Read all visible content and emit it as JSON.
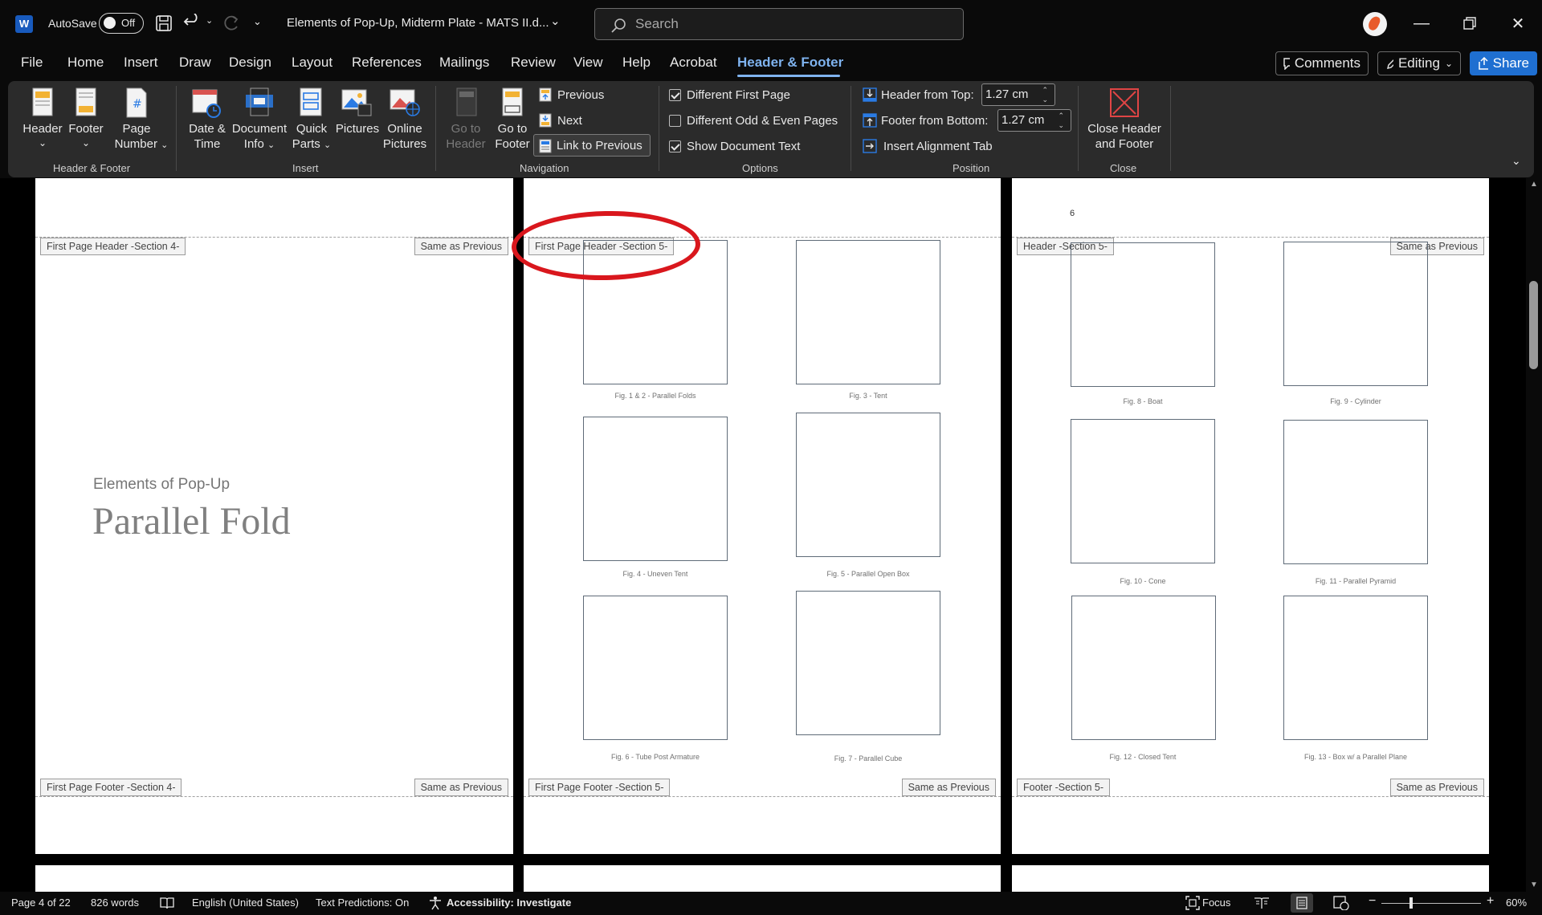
{
  "title_bar": {
    "autosave_label": "AutoSave",
    "autosave_state": "Off",
    "document_title": "Elements of Pop-Up, Midterm Plate - MATS II.d...",
    "search_placeholder": "Search"
  },
  "menu": {
    "tabs": [
      "File",
      "Home",
      "Insert",
      "Draw",
      "Design",
      "Layout",
      "References",
      "Mailings",
      "Review",
      "View",
      "Help",
      "Acrobat",
      "Header & Footer"
    ],
    "active_tab": "Header & Footer",
    "comments": "Comments",
    "editing": "Editing",
    "share": "Share"
  },
  "ribbon": {
    "header_footer_group": {
      "label": "Header & Footer",
      "header": "Header",
      "footer": "Footer",
      "page": "Page",
      "number": "Number"
    },
    "insert_group": {
      "label": "Insert",
      "date1": "Date &",
      "date2": "Time",
      "doc1": "Document",
      "doc2": "Info",
      "quick1": "Quick",
      "quick2": "Parts",
      "pictures": "Pictures",
      "online1": "Online",
      "online2": "Pictures"
    },
    "navigation_group": {
      "label": "Navigation",
      "goto_header1": "Go to",
      "goto_header2": "Header",
      "goto_footer1": "Go to",
      "goto_footer2": "Footer",
      "previous": "Previous",
      "next": "Next",
      "link_previous": "Link to Previous"
    },
    "options_group": {
      "label": "Options",
      "different_first": "Different First Page",
      "different_odd_even": "Different Odd & Even Pages",
      "show_document_text": "Show Document Text"
    },
    "position_group": {
      "label": "Position",
      "header_from_top": "Header from Top:",
      "header_value": "1.27 cm",
      "footer_from_bottom": "Footer from Bottom:",
      "footer_value": "1.27 cm",
      "insert_alignment_tab": "Insert Alignment Tab"
    },
    "close_group": {
      "label": "Close",
      "close1": "Close Header",
      "close2": "and Footer"
    },
    "colors": {
      "accent": "#7fb3ef",
      "share_bg": "#1f6fd1",
      "close_red": "#e04545"
    }
  },
  "pages": {
    "page1": {
      "header_label": "First Page Header -Section 4-",
      "header_same": "Same as Previous",
      "footer_label": "First Page Footer -Section 4-",
      "footer_same": "Same as Previous",
      "subtitle": "Elements of Pop-Up",
      "title": "Parallel Fold"
    },
    "page2": {
      "header_label": "First Page Header -Section 5-",
      "footer_label": "First Page Footer -Section 5-",
      "footer_same": "Same as Previous",
      "captions": [
        "Fig. 1 & 2 - Parallel Folds",
        "Fig. 3 - Tent",
        "Fig. 4 - Uneven Tent",
        "Fig. 5 - Parallel Open Box",
        "Fig. 6 - Tube Post Armature",
        "Fig. 7 - Parallel Cube"
      ]
    },
    "page3": {
      "page_number": "6",
      "header_label": "Header -Section 5-",
      "header_same": "Same as Previous",
      "footer_label": "Footer -Section 5-",
      "footer_same": "Same as Previous",
      "captions": [
        "Fig. 8 - Boat",
        "Fig. 9 - Cylinder",
        "Fig. 10 - Cone",
        "Fig. 11 - Parallel Pyramid",
        "Fig. 12 - Closed Tent",
        "Fig. 13 - Box w/ a Parallel Plane"
      ]
    }
  },
  "status_bar": {
    "page": "Page 4 of 22",
    "words": "826 words",
    "language": "English (United States)",
    "text_predictions": "Text Predictions: On",
    "accessibility": "Accessibility: Investigate",
    "focus": "Focus",
    "zoom": "60%"
  }
}
